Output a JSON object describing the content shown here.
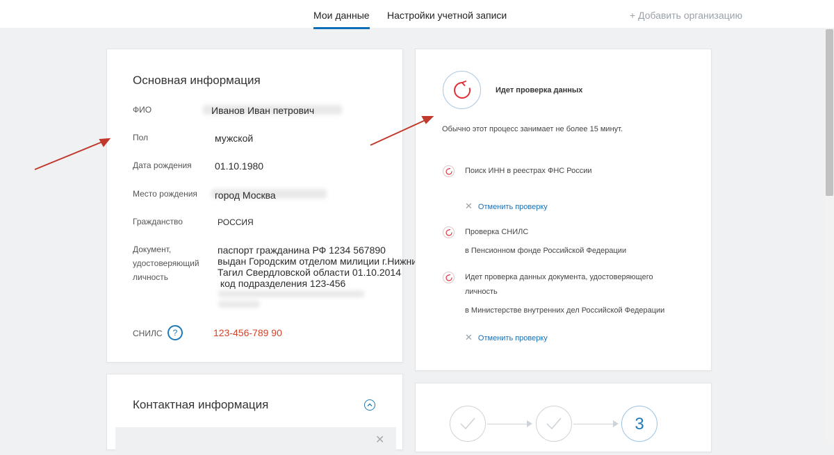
{
  "tabs": [
    {
      "label": "Мои данные",
      "active": true
    },
    {
      "label": "Настройки учетной записи",
      "active": false
    }
  ],
  "add_org_label": "+ Добавить организацию",
  "main_info": {
    "title": "Основная информация",
    "fields": [
      {
        "label": "ФИО",
        "value": "Иванов Иван петрович"
      },
      {
        "label": "Пол",
        "value": "мужской"
      },
      {
        "label": "Дата рождения",
        "value": "01.10.1980"
      },
      {
        "label": "Место рождения",
        "value": "город Москва"
      },
      {
        "label": "Гражданство",
        "value": "РОССИЯ"
      }
    ],
    "document": {
      "label_lines": [
        "Документ,",
        "удостоверяющий",
        "личность"
      ],
      "value_lines": [
        "паспорт гражданина РФ 1234 567890",
        "выдан Городским отделом милиции г.Нижний",
        "Тагил Свердловской области 01.10.2014",
        " код подразделения 123-456"
      ]
    },
    "snils": {
      "label": "СНИЛС",
      "help": "?",
      "value": "123-456-789 90"
    }
  },
  "verification": {
    "title": "Идет проверка данных",
    "subtitle": "Обычно этот процесс занимает не более 15 минут.",
    "items": [
      {
        "text": "Поиск ИНН в реестрах ФНС России"
      },
      {
        "text": "Проверка СНИЛС",
        "sub": "в Пенсионном фонде Российской Федерации"
      },
      {
        "text": "Идет проверка данных документа, удостоверяющего",
        "text2": "личность",
        "sub": "в Министерстве внутренних дел Российской Федерации"
      }
    ],
    "cancel_label": "Отменить проверку"
  },
  "contact": {
    "title": "Контактная информация"
  },
  "steps": {
    "current": "3"
  },
  "colors": {
    "accent": "#0d6fb8",
    "snils": "#d0442b",
    "spinner": "#e0303a",
    "annotation_arrow": "#c0392b"
  }
}
